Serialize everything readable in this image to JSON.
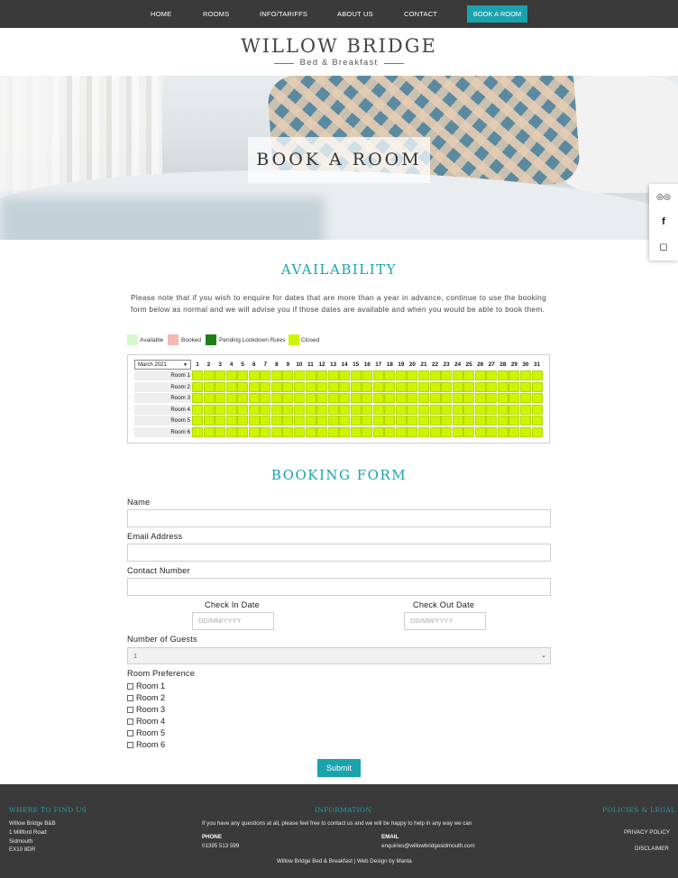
{
  "nav": {
    "items": [
      "HOME",
      "ROOMS",
      "INFO/TARIFFS",
      "ABOUT US",
      "CONTACT"
    ],
    "cta": "BOOK A ROOM"
  },
  "logo": {
    "title": "WILLOW BRIDGE",
    "subtitle": "Bed & Breakfast"
  },
  "hero": {
    "title": "BOOK A ROOM"
  },
  "social": {
    "icons": [
      "tripadvisor-icon",
      "facebook-icon",
      "instagram-icon"
    ],
    "glyphs": [
      "◎◎",
      "f",
      "◻"
    ]
  },
  "availability": {
    "title": "AVAILABILITY",
    "intro": "Please note that if you wish to enquire for dates that are more than a year in advance, continue to use the booking form below as normal and we will advise you if those dates are available and when you would be able to book them.",
    "legend": [
      {
        "label": "Available",
        "color": "#d6f7cf"
      },
      {
        "label": "Booked",
        "color": "#f6b8b4"
      },
      {
        "label": "Pending Lockdown Rules",
        "color": "#1f7f14"
      },
      {
        "label": "Closed",
        "color": "#cff400"
      }
    ],
    "calendar": {
      "month": "March 2021",
      "days": [
        "1",
        "2",
        "3",
        "4",
        "5",
        "6",
        "7",
        "8",
        "9",
        "10",
        "11",
        "12",
        "13",
        "14",
        "15",
        "16",
        "17",
        "18",
        "19",
        "20",
        "21",
        "22",
        "23",
        "24",
        "25",
        "26",
        "27",
        "28",
        "29",
        "30",
        "31"
      ],
      "rooms": [
        "Room 1",
        "Room 2",
        "Room 3",
        "Room 4",
        "Room 5",
        "Room 6"
      ],
      "cell_status": "Closed"
    }
  },
  "booking": {
    "title": "BOOKING FORM",
    "name_label": "Name",
    "email_label": "Email Address",
    "contact_label": "Contact Number",
    "checkin_label": "Check In Date",
    "checkin_placeholder": "DD/MM/YYYY",
    "checkout_label": "Check Out Date",
    "checkout_placeholder": "DD/MM/YYYY",
    "guests_label": "Number of Guests",
    "guests_value": "1",
    "room_pref_label": "Room Preference",
    "room_options": [
      "Room 1",
      "Room 2",
      "Room 3",
      "Room 4",
      "Room 5",
      "Room 6"
    ],
    "submit": "Submit"
  },
  "footer": {
    "find_heading": "WHERE TO FIND US",
    "address": [
      "Willow Bridge B&B",
      "1 Millford Road",
      "Sidmouth",
      "EX10 8DR"
    ],
    "info_heading": "INFORMATION",
    "info_text": "If you have any questions at all, please feel free to contact us and we will be happy to help in any way we can",
    "phone_label": "PHONE",
    "phone": "01395 513 599",
    "email_label": "EMAIL",
    "email": "enquiries@willowbridgesidmouth.com",
    "policies_heading": "POLICIES & LEGAL",
    "privacy": "PRIVACY POLICY",
    "disclaimer": "DISCLAIMER",
    "credit": "Willow Bridge Bed & Breakfast | Web Design by Manta"
  },
  "colors": {
    "accent": "#1ba3ad",
    "dark": "#3a3a3a",
    "closed": "#cff400"
  }
}
